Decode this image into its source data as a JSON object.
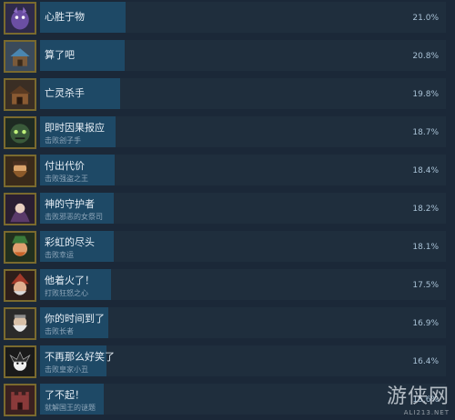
{
  "achievements": [
    {
      "title": "心胜于物",
      "desc": "",
      "percent": "21.0%",
      "fill": 0.21,
      "icon": "purple-creature-icon",
      "color": "#6b4fa3"
    },
    {
      "title": "算了吧",
      "desc": "",
      "percent": "20.8%",
      "fill": 0.208,
      "icon": "house-icon",
      "color": "#4a86b0"
    },
    {
      "title": "亡灵杀手",
      "desc": "",
      "percent": "19.8%",
      "fill": 0.198,
      "icon": "wooden-cabin-icon",
      "color": "#8a5a32"
    },
    {
      "title": "即时因果报应",
      "desc": "击败刽子手",
      "percent": "18.7%",
      "fill": 0.187,
      "icon": "dark-green-monster-icon",
      "color": "#3a5a3a"
    },
    {
      "title": "付出代价",
      "desc": "击败强盗之王",
      "percent": "18.4%",
      "fill": 0.184,
      "icon": "bearded-bandit-icon",
      "color": "#8c5a2a"
    },
    {
      "title": "神的守护者",
      "desc": "击败邪恶的女祭司",
      "percent": "18.2%",
      "fill": 0.182,
      "icon": "dark-priestess-icon",
      "color": "#5a3a6a"
    },
    {
      "title": "彩虹的尽头",
      "desc": "击败幸运",
      "percent": "18.1%",
      "fill": 0.181,
      "icon": "leprechaun-icon",
      "color": "#3a7a3a"
    },
    {
      "title": "他着火了！",
      "desc": "打败狂怒之心",
      "percent": "17.5%",
      "fill": 0.175,
      "icon": "red-hat-wizard-icon",
      "color": "#a33a2a"
    },
    {
      "title": "你的时间到了",
      "desc": "击败长者",
      "percent": "16.9%",
      "fill": 0.169,
      "icon": "old-sage-icon",
      "color": "#8a8a8a"
    },
    {
      "title": "不再那么好笑了",
      "desc": "击败皇家小丑",
      "percent": "16.4%",
      "fill": 0.164,
      "icon": "jester-icon",
      "color": "#2a2a2a"
    },
    {
      "title": "了不起！",
      "desc": "就解国王的谜题",
      "percent": "15.6%",
      "fill": 0.156,
      "icon": "castle-icon",
      "color": "#8a3a3a"
    }
  ],
  "watermark": {
    "main": "游侠网",
    "sub": "ALI213.NET"
  }
}
